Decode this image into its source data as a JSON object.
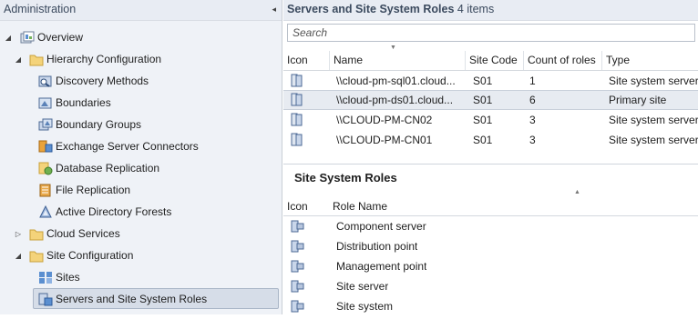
{
  "nav": {
    "header": "Administration",
    "collapse_glyph": "◂",
    "items": [
      {
        "label": "Overview",
        "icon": "overview-icon",
        "expanded": true
      },
      {
        "label": "Hierarchy Configuration",
        "icon": "folder-icon",
        "expanded": true
      },
      {
        "label": "Discovery Methods",
        "icon": "discovery-icon"
      },
      {
        "label": "Boundaries",
        "icon": "boundary-icon"
      },
      {
        "label": "Boundary Groups",
        "icon": "boundary-group-icon"
      },
      {
        "label": "Exchange Server Connectors",
        "icon": "exchange-connector-icon"
      },
      {
        "label": "Database Replication",
        "icon": "database-replication-icon"
      },
      {
        "label": "File Replication",
        "icon": "file-replication-icon"
      },
      {
        "label": "Active Directory Forests",
        "icon": "ad-forest-icon"
      },
      {
        "label": "Cloud Services",
        "icon": "folder-icon",
        "expanded": false
      },
      {
        "label": "Site Configuration",
        "icon": "folder-icon",
        "expanded": true
      },
      {
        "label": "Sites",
        "icon": "sites-icon"
      },
      {
        "label": "Servers and Site System Roles",
        "icon": "servers-roles-icon",
        "selected": true
      }
    ]
  },
  "content": {
    "title": "Servers and Site System Roles",
    "count": "4 items",
    "search_placeholder": "Search",
    "columns": [
      "Icon",
      "Name",
      "Site Code",
      "Count of roles",
      "Type"
    ],
    "rows": [
      {
        "name": "\\\\cloud-pm-sql01.cloud...",
        "site_code": "S01",
        "roles": "1",
        "type": "Site system server"
      },
      {
        "name": "\\\\cloud-pm-ds01.cloud...",
        "site_code": "S01",
        "roles": "6",
        "type": "Primary site"
      },
      {
        "name": "\\\\CLOUD-PM-CN02",
        "site_code": "S01",
        "roles": "3",
        "type": "Site system server"
      },
      {
        "name": "\\\\CLOUD-PM-CN01",
        "site_code": "S01",
        "roles": "3",
        "type": "Site system server"
      }
    ]
  },
  "roles_section": {
    "title": "Site System Roles",
    "columns": [
      "Icon",
      "Role Name"
    ],
    "roles": [
      "Component server",
      "Distribution point",
      "Management point",
      "Site server",
      "Site system"
    ]
  },
  "colors": {
    "selected_bg": "#d6dde8",
    "nav_bg": "#eff2f7",
    "folder": "#e8c15a"
  }
}
